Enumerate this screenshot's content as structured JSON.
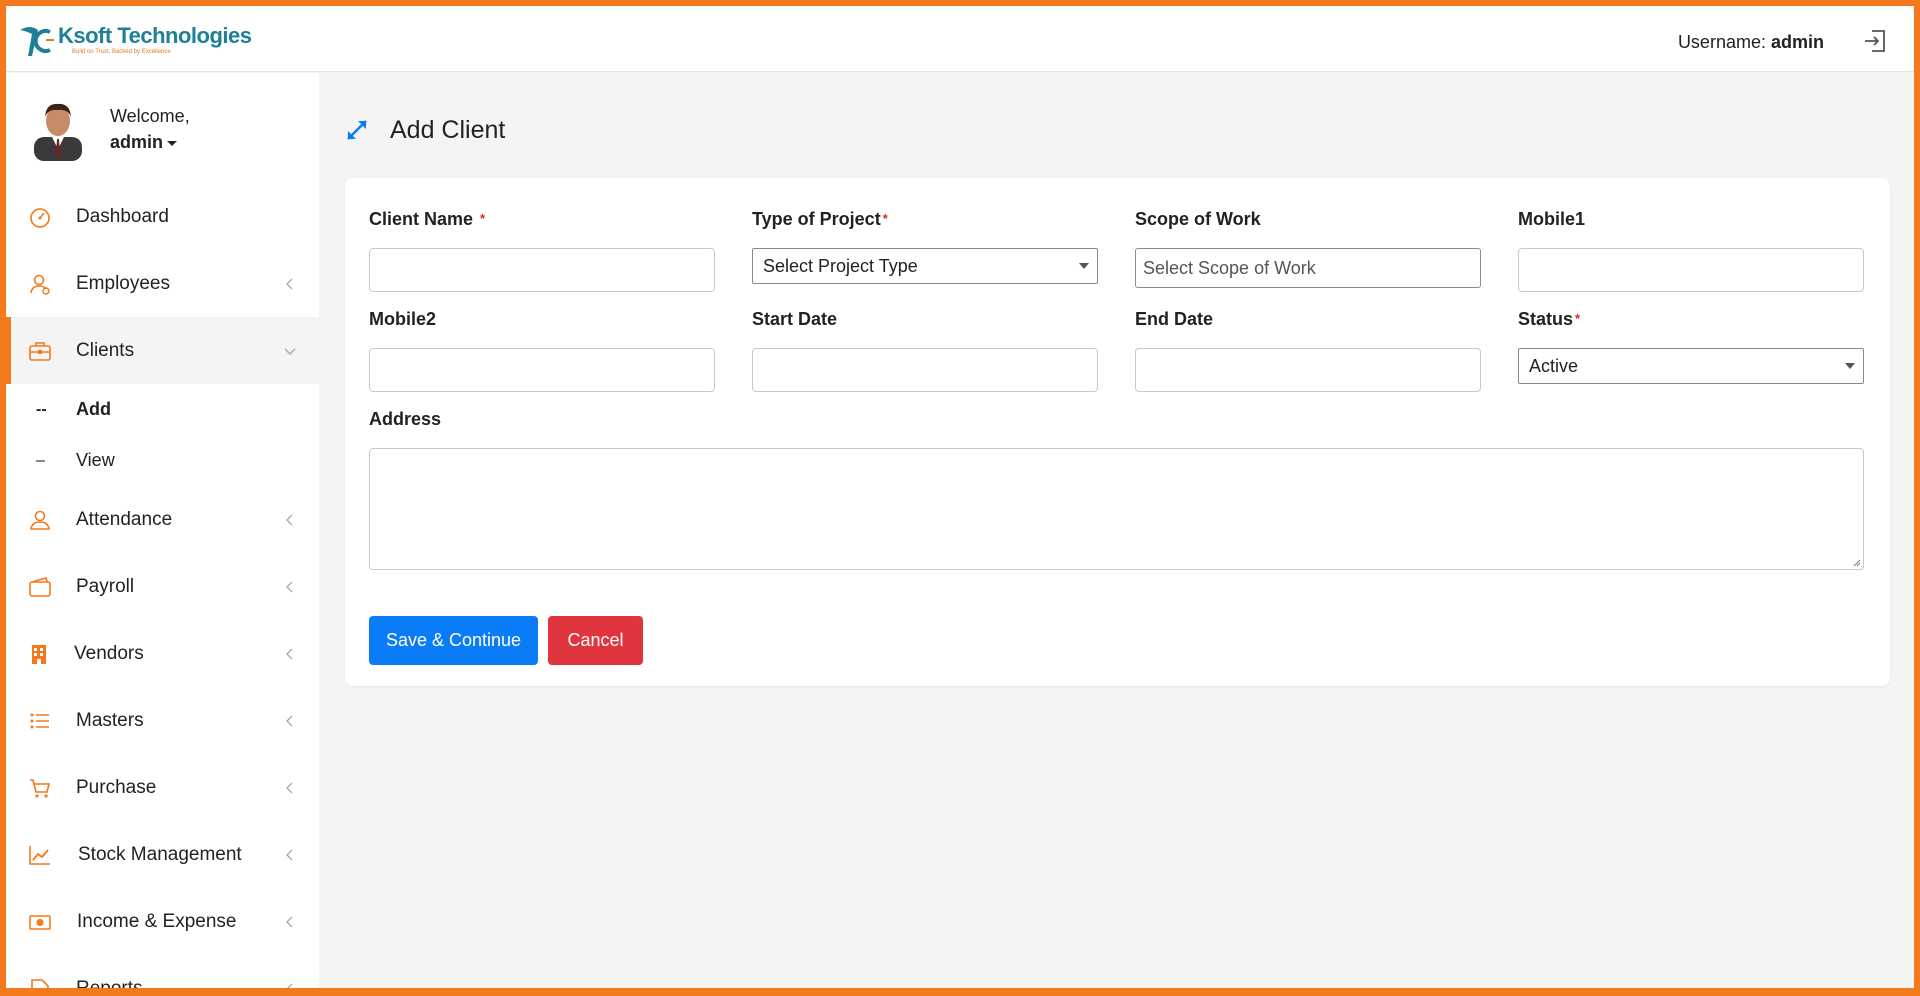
{
  "brand": {
    "name": "Ksoft Technologies",
    "tagline": "Build on Trust, Backed by Excellence"
  },
  "header": {
    "username_label": "Username:",
    "username_value": "admin"
  },
  "sidebar": {
    "welcome": "Welcome,",
    "user": "admin",
    "items": [
      {
        "label": "Dashboard",
        "icon": "dashboard-icon"
      },
      {
        "label": "Employees",
        "icon": "employees-icon"
      },
      {
        "label": "Clients",
        "icon": "clients-icon"
      },
      {
        "label": "Attendance",
        "icon": "attendance-icon"
      },
      {
        "label": "Payroll",
        "icon": "payroll-icon"
      },
      {
        "label": "Vendors",
        "icon": "vendors-icon"
      },
      {
        "label": "Masters",
        "icon": "masters-icon"
      },
      {
        "label": "Purchase",
        "icon": "purchase-icon"
      },
      {
        "label": "Stock Management",
        "icon": "stock-icon"
      },
      {
        "label": "Income & Expense",
        "icon": "income-icon"
      },
      {
        "label": "Reports",
        "icon": "reports-icon"
      }
    ],
    "sub_items": [
      {
        "dash": "--",
        "label": "Add"
      },
      {
        "dash": "–",
        "label": "View"
      }
    ]
  },
  "page": {
    "title": "Add Client"
  },
  "form": {
    "client_name_label": "Client Name",
    "type_label": "Type of Project",
    "type_value": "Select Project Type",
    "scope_label": "Scope of Work",
    "scope_placeholder": "Select Scope of Work",
    "mobile1_label": "Mobile1",
    "mobile2_label": "Mobile2",
    "start_label": "Start Date",
    "end_label": "End Date",
    "status_label": "Status",
    "status_value": "Active",
    "address_label": "Address",
    "required_mark": "*",
    "save_label": "Save & Continue",
    "cancel_label": "Cancel"
  },
  "colors": {
    "accent": "#f3791c",
    "primary": "#0b7cf7",
    "danger": "#e0353f",
    "brand_teal": "#1d7f98"
  }
}
